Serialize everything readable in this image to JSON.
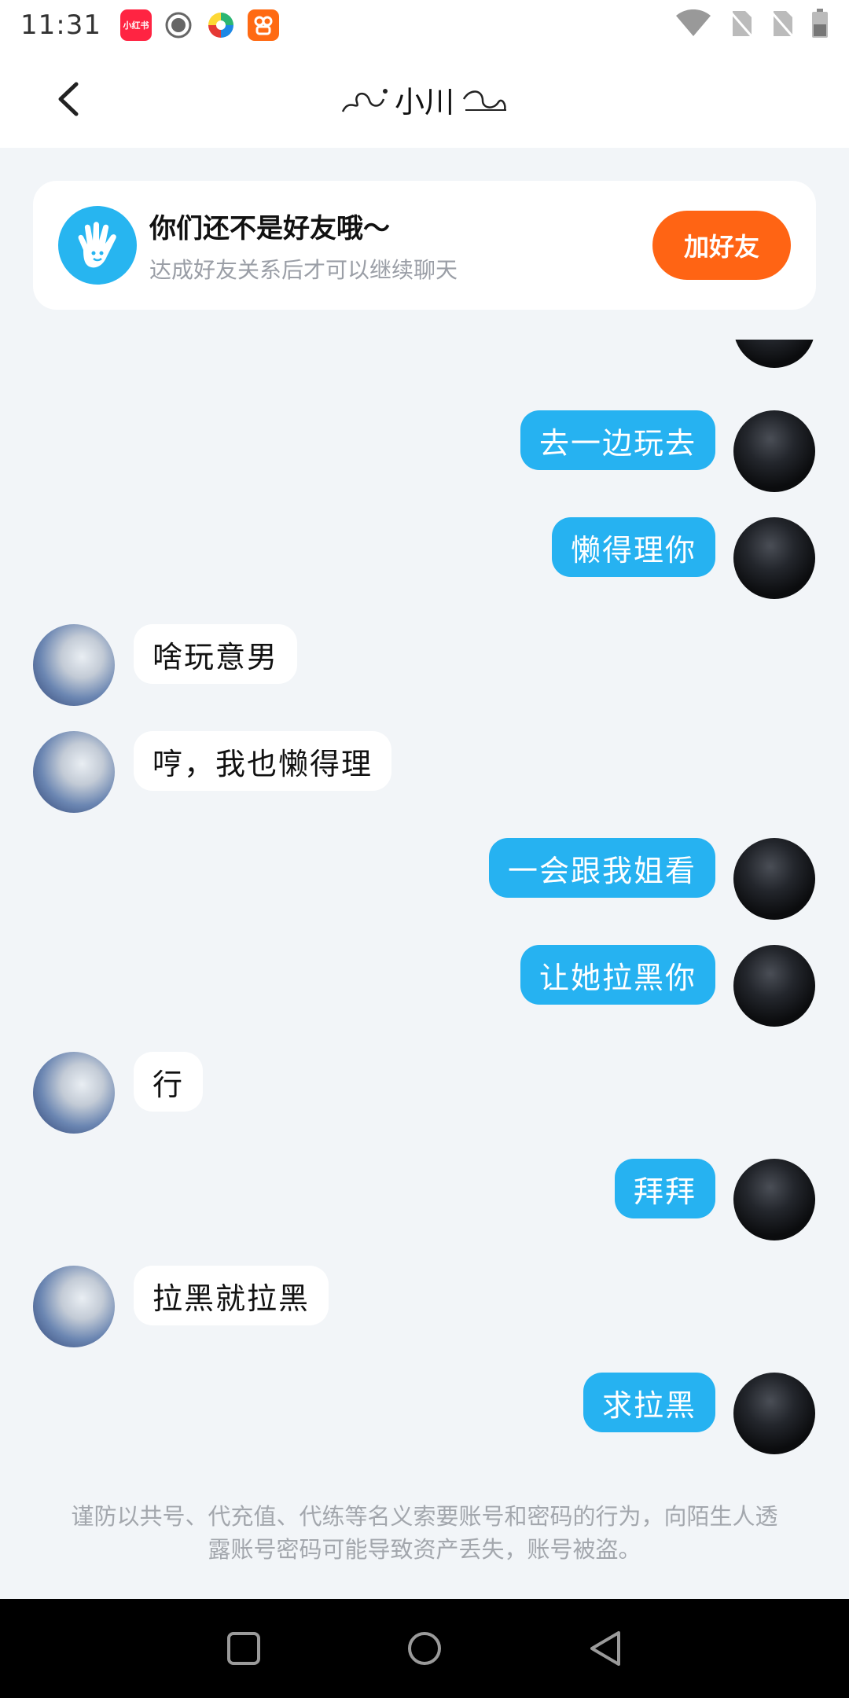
{
  "status_bar": {
    "time": "11:31",
    "apps": [
      "xiaohongshu-icon",
      "record-icon",
      "pinwheel-icon",
      "kuaishou-icon"
    ],
    "xiaohongshu_label": "小红书"
  },
  "header": {
    "title": "小川"
  },
  "friend_banner": {
    "title": "你们还不是好友哦～",
    "subtitle": "达成好友关系后才可以继续聊天",
    "button_label": "加好友"
  },
  "messages": [
    {
      "from": "me",
      "text": "去一边玩去"
    },
    {
      "from": "me",
      "text": "懒得理你"
    },
    {
      "from": "other",
      "text": "啥玩意男"
    },
    {
      "from": "other",
      "text": "哼，我也懒得理"
    },
    {
      "from": "me",
      "text": "一会跟我姐看"
    },
    {
      "from": "me",
      "text": "让她拉黑你"
    },
    {
      "from": "other",
      "text": "行"
    },
    {
      "from": "me",
      "text": "拜拜"
    },
    {
      "from": "other",
      "text": "拉黑就拉黑"
    },
    {
      "from": "me",
      "text": "求拉黑"
    }
  ],
  "notice": "谨防以共号、代充值、代练等名义索要账号和密码的行为，向陌生人透露账号密码可能导致资产丢失，账号被盗。",
  "colors": {
    "my_bubble": "#26b2f1",
    "accent_button": "#ff6414",
    "background": "#f2f5f8"
  }
}
